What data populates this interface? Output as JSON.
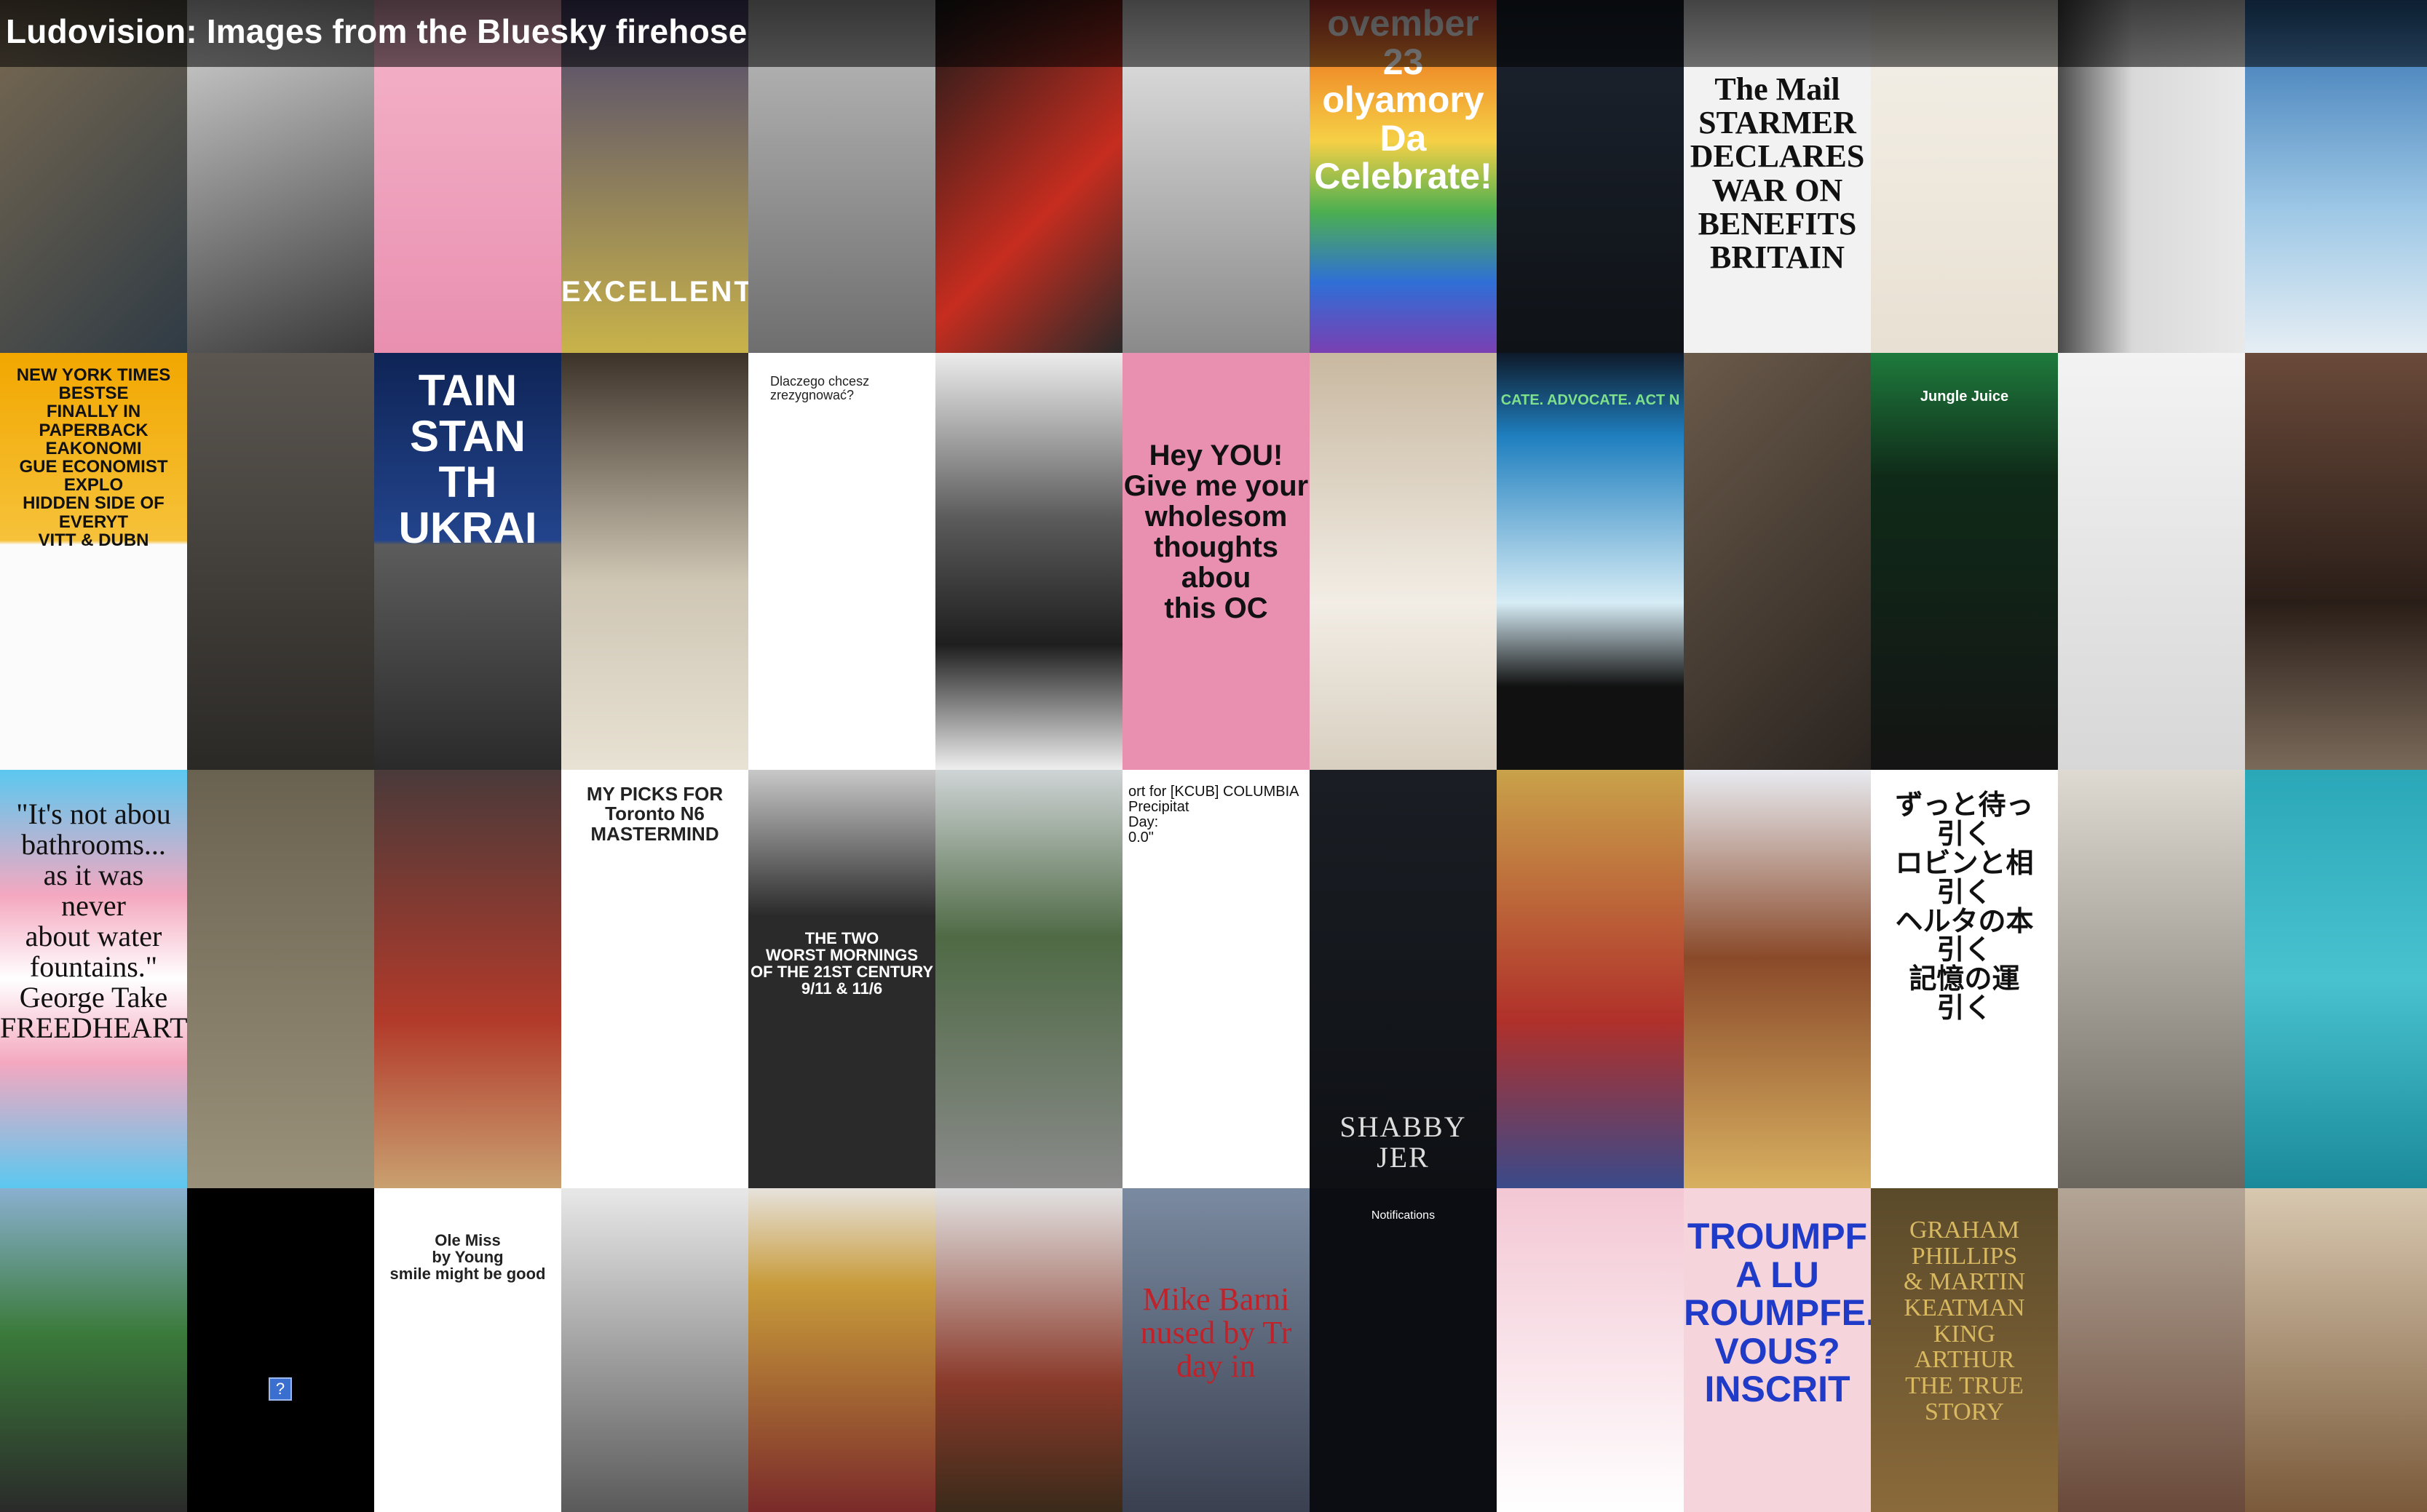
{
  "page": {
    "title": "Ludovision: Images from the Bluesky firehose"
  },
  "mosaic": {
    "tiles": [
      {
        "id": "r0c0",
        "text": "",
        "bg": "linear-gradient(135deg,#7a6a52,#2f3b45)"
      },
      {
        "id": "r0c1",
        "text": "",
        "bg": "linear-gradient(160deg,#d8d8d8,#3a3a3a)"
      },
      {
        "id": "r0c2",
        "text": "",
        "bg": "linear-gradient(180deg,#f4b5c9,#e98fb0)"
      },
      {
        "id": "r0c3",
        "text": "EXCELLENT",
        "bg": "linear-gradient(180deg,#4a4470,#c9b34a)"
      },
      {
        "id": "r0c4",
        "text": "",
        "bg": "linear-gradient(180deg,#bdbdbd,#6e6e6e)"
      },
      {
        "id": "r0c5",
        "text": "",
        "bg": "linear-gradient(135deg,#1a1a1a,#c62d1f 60%,#2a2a2a)"
      },
      {
        "id": "r0c6",
        "text": "",
        "bg": "linear-gradient(180deg,#e9e9e9,#8a8a8a)"
      },
      {
        "id": "r0c7",
        "text": "ovember 23\nolyamory Da\nCelebrate!",
        "bg": "linear-gradient(180deg,#e6433a,#f0932b,#f6d046,#4caf50,#2f6fd6,#7a3fb2)"
      },
      {
        "id": "r0c8",
        "text": "",
        "bg": "linear-gradient(180deg,#1c2430,#0f1216)"
      },
      {
        "id": "r0c9",
        "text": "The Mail\nSTARMER DECLARES WAR ON BENEFITS BRITAIN",
        "bg": "#f2f2f2"
      },
      {
        "id": "r0c10",
        "text": "",
        "bg": "linear-gradient(180deg,#f4f0e8,#e8e0d2)"
      },
      {
        "id": "r0c11",
        "text": "",
        "bg": "linear-gradient(90deg,#4a4a4a,#d9d9d9 40%,#e9e9e9)"
      },
      {
        "id": "r0c12",
        "text": "",
        "bg": "linear-gradient(180deg,#2f6fb0,#9ec8e6 60%,#e6eef4)"
      },
      {
        "id": "r1c0",
        "text": "NEW YORK TIMES BESTSE\nFINALLY IN PAPERBACK\nEAKONOMI\nGUE ECONOMIST EXPLO\nHIDDEN SIDE OF EVERYT\nVITT & DUBN",
        "bg": "linear-gradient(180deg,#f2a700,#f6c23a 45%,#fbfbfb 46%)"
      },
      {
        "id": "r1c1",
        "text": "",
        "bg": "linear-gradient(180deg,#5b5650,#2b2926)"
      },
      {
        "id": "r1c2",
        "text": "TAIN STAN\nTH UKRAI",
        "bg": "linear-gradient(180deg,#0e2456,#23448c 45%,#5c5c5c 46%,#2a2a2a)"
      },
      {
        "id": "r1c3",
        "text": "",
        "bg": "linear-gradient(180deg,#3d3228,#cfc6b4 55%,#e8e2d4)"
      },
      {
        "id": "r1c4",
        "text": "Dlaczego chcesz zrezygnować?",
        "bg": "#ffffff"
      },
      {
        "id": "r1c5",
        "text": "",
        "bg": "linear-gradient(180deg,#ececec,#5a5a5a 40%,#1e1e1e 70%,#efefef)"
      },
      {
        "id": "r1c6",
        "text": "Hey YOU!\nGive me your\nwholesom\nthoughts abou\nthis OC",
        "bg": "#e98fb0"
      },
      {
        "id": "r1c7",
        "text": "",
        "bg": "linear-gradient(180deg,#c8b8a0,#f2ede5 60%,#d8cfc0)"
      },
      {
        "id": "r1c8",
        "text": "CATE. ADVOCATE. ACT N",
        "bg": "linear-gradient(180deg,#0e1a2a,#1f7fbf 20%,#d6ecf5 60%,#111 80%)"
      },
      {
        "id": "r1c9",
        "text": "",
        "bg": "linear-gradient(135deg,#6a5a4a,#2a2420)"
      },
      {
        "id": "r1c10",
        "text": "Jungle Juice",
        "bg": "linear-gradient(180deg,#1e7a3c,#0f2a18 30%,#141414)"
      },
      {
        "id": "r1c11",
        "text": "",
        "bg": "linear-gradient(180deg,#f3f3f3,#d7d7d7)"
      },
      {
        "id": "r1c12",
        "text": "",
        "bg": "linear-gradient(180deg,#6a4a3a,#2a1e18 60%,#7a6a5a)"
      },
      {
        "id": "r2c0",
        "text": "\"It's not abou\nbathrooms...\nas it was\nnever\nabout water\nfountains.\"\nGeorge Take\nFREEDHEARTS.ORG",
        "bg": "linear-gradient(180deg,#5bc8f0,#f4a8c0 30%,#ffffff 50%,#f4a8c0 70%,#5bc8f0)"
      },
      {
        "id": "r2c1",
        "text": "",
        "bg": "linear-gradient(180deg,#6a6250,#9a917a)"
      },
      {
        "id": "r2c2",
        "text": "",
        "bg": "linear-gradient(180deg,#4a3a3a,#b23a2a 60%,#c9a070)"
      },
      {
        "id": "r2c3",
        "text": "MY PICKS FOR\nToronto N6\nMASTERMIND",
        "bg": "#ffffff"
      },
      {
        "id": "r2c4",
        "text": "THE TWO\nWORST MORNINGS\nOF THE 21ST CENTURY\n9/11 & 11/6",
        "bg": "linear-gradient(180deg,#c8c8c8,#2a2a2a 35%)"
      },
      {
        "id": "r2c5",
        "text": "",
        "bg": "linear-gradient(180deg,#cfd4d6,#4f6a45 40%,#8a8a8a)"
      },
      {
        "id": "r2c6",
        "text": "ort for [KCUB] COLUMBIA\nPrecipitat\nDay:\n0.0\"",
        "bg": "#ffffff"
      },
      {
        "id": "r2c7",
        "text": "SHABBY JER",
        "bg": "linear-gradient(180deg,#1a1e24,#0e1014)"
      },
      {
        "id": "r2c8",
        "text": "",
        "bg": "linear-gradient(180deg,#c9a24a,#b0302a 60%,#3a4a8a)"
      },
      {
        "id": "r2c9",
        "text": "",
        "bg": "linear-gradient(180deg,#e8eaf0,#8a4a2a 45%,#d8b060)"
      },
      {
        "id": "r2c10",
        "text": "ずっと待っ\n引く\nロビンと相\n引く\nヘルタの本\n引く\n記憶の運\n引く",
        "bg": "#ffffff"
      },
      {
        "id": "r2c11",
        "text": "",
        "bg": "linear-gradient(180deg,#dedad2,#6a665e)"
      },
      {
        "id": "r2c12",
        "text": "",
        "bg": "linear-gradient(180deg,#2aa7b8,#49c2cf 50%,#1a8a9a)"
      },
      {
        "id": "r3c0",
        "text": "",
        "bg": "linear-gradient(180deg,#8ab0d0,#3a7a3a 45%,#2a2a2a)"
      },
      {
        "id": "r3c1",
        "text": "",
        "bg": "#000000"
      },
      {
        "id": "r3c2",
        "text": "Ole Miss\nby Young\nsmile might be good",
        "bg": "#ffffff"
      },
      {
        "id": "r3c3",
        "text": "",
        "bg": "linear-gradient(180deg,#e8e8e8,#5a5a5a)"
      },
      {
        "id": "r3c4",
        "text": "",
        "bg": "linear-gradient(180deg,#e6e2dc,#c89b3a 30%,#7a2a2a)"
      },
      {
        "id": "r3c5",
        "text": "",
        "bg": "linear-gradient(180deg,#e2e2e2,#8a3a2a 60%,#3a2a1a)"
      },
      {
        "id": "r3c6",
        "text": "Mike Barni\nnused by Tr\nday in",
        "bg": "linear-gradient(180deg,#7a8aa0,#3a4050)"
      },
      {
        "id": "r3c7",
        "text": "Notifications",
        "bg": "#0c0d12"
      },
      {
        "id": "r3c8",
        "text": "",
        "bg": "linear-gradient(180deg,#f3c7d4,#ffffff)"
      },
      {
        "id": "r3c9",
        "text": "TROUMPF A LU\nROUMPFE.\nVOUS?\nINSCRIT",
        "bg": "#f6d4dc"
      },
      {
        "id": "r3c10",
        "text": "GRAHAM PHILLIPS\n& MARTIN KEATMAN\nKING\nARTHUR\nTHE TRUE\nSTORY",
        "bg": "linear-gradient(180deg,#5a4a2a,#8a6a3a)"
      },
      {
        "id": "r3c11",
        "text": "",
        "bg": "linear-gradient(180deg,#b3a596,#6a4a3a)"
      },
      {
        "id": "r3c12",
        "text": "",
        "bg": "linear-gradient(180deg,#d8c8b0,#7a5a3a)"
      }
    ]
  },
  "colors": {
    "title_text": "#ffffff",
    "title_bar": "#000000"
  }
}
